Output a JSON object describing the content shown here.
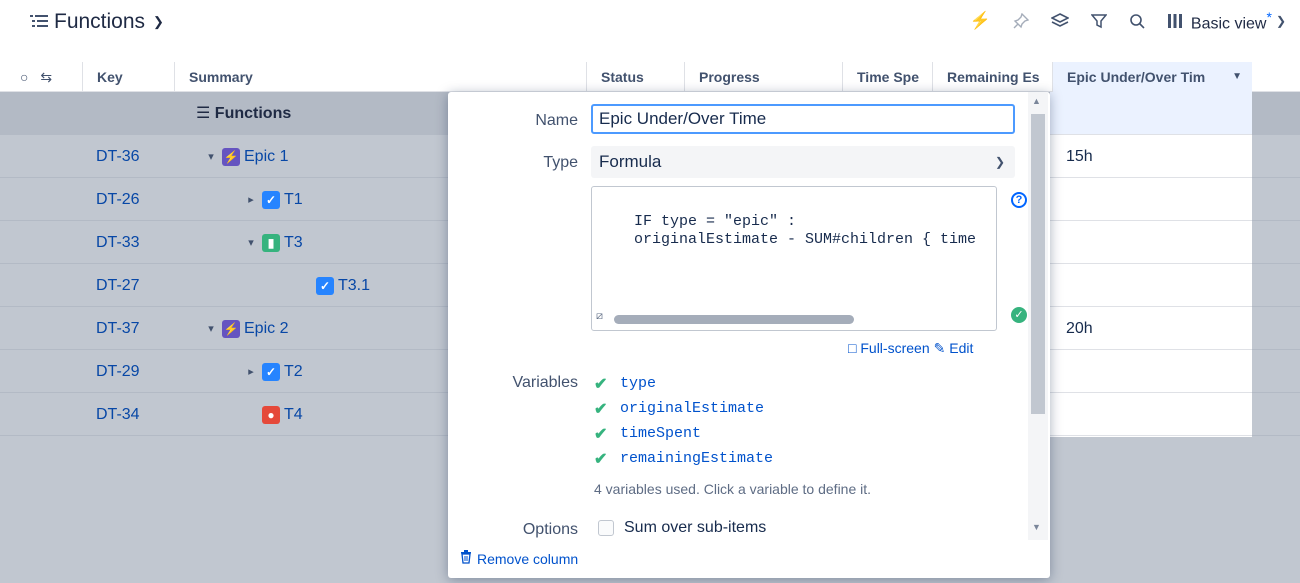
{
  "header": {
    "title": "Functions",
    "view_label": "Basic view",
    "view_modified": "*"
  },
  "columns": [
    "Key",
    "Summary",
    "Status",
    "Progress",
    "Time Spe",
    "Remaining Es",
    "Epic Under/Over Tim"
  ],
  "root_row": {
    "summary": "Functions"
  },
  "rows": [
    {
      "key": "DT-36",
      "summary": "Epic 1",
      "type": "epic",
      "toggle": "▾",
      "epic_value": "15h"
    },
    {
      "key": "DT-26",
      "summary": "T1",
      "type": "task",
      "toggle": "▸",
      "epic_value": ""
    },
    {
      "key": "DT-33",
      "summary": "T3",
      "type": "story",
      "toggle": "▾",
      "epic_value": ""
    },
    {
      "key": "DT-27",
      "summary": "T3.1",
      "type": "task",
      "toggle": "",
      "epic_value": ""
    },
    {
      "key": "DT-37",
      "summary": "Epic 2",
      "type": "epic",
      "toggle": "▾",
      "epic_value": "20h"
    },
    {
      "key": "DT-29",
      "summary": "T2",
      "type": "task",
      "toggle": "▸",
      "epic_value": ""
    },
    {
      "key": "DT-34",
      "summary": "T4",
      "type": "bug",
      "toggle": "",
      "epic_value": ""
    }
  ],
  "panel": {
    "name_label": "Name",
    "name_value": "Epic Under/Over Time",
    "type_label": "Type",
    "type_value": "Formula",
    "formula": "IF type = \"epic\" :\n    originalEstimate - SUM#children { time",
    "fullscreen_link": "Full-screen",
    "edit_link": "Edit",
    "variables_label": "Variables",
    "variables": [
      "type",
      "originalEstimate",
      "timeSpent",
      "remainingEstimate"
    ],
    "variables_note": "4 variables used. Click a variable to define it.",
    "options_label": "Options",
    "option_sum": "Sum over sub-items",
    "remove_column": "Remove column"
  }
}
